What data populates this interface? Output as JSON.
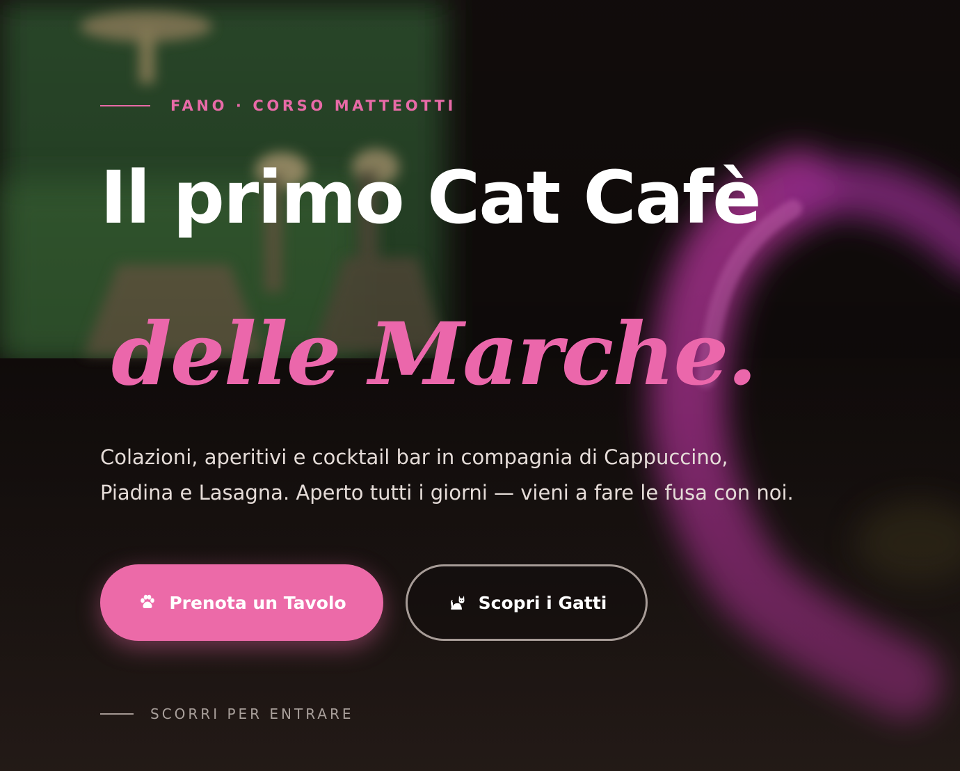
{
  "hero": {
    "eyebrow": "FANO · CORSO MATTEOTTI",
    "title_line1": "Il primo Cat Cafè",
    "title_line2": "delle Marche.",
    "lead_line1": "Colazioni, aperitivi e cocktail bar in compagnia di Cappuccino,",
    "lead_line2": "Piadina e Lasagna. Aperto tutti i giorni — vieni a fare le fusa con noi.",
    "primary_cta": {
      "label": "Prenota un Tavolo",
      "icon": "paw-icon"
    },
    "secondary_cta": {
      "label": "Scopri i Gatti",
      "icon": "cat-icon"
    },
    "scroll_hint": "SCORRI PER ENTRARE"
  },
  "colors": {
    "accent": "#ec6aa8",
    "background": "#120d0c",
    "text": "#ffffff",
    "muted": "#a9a09b"
  }
}
